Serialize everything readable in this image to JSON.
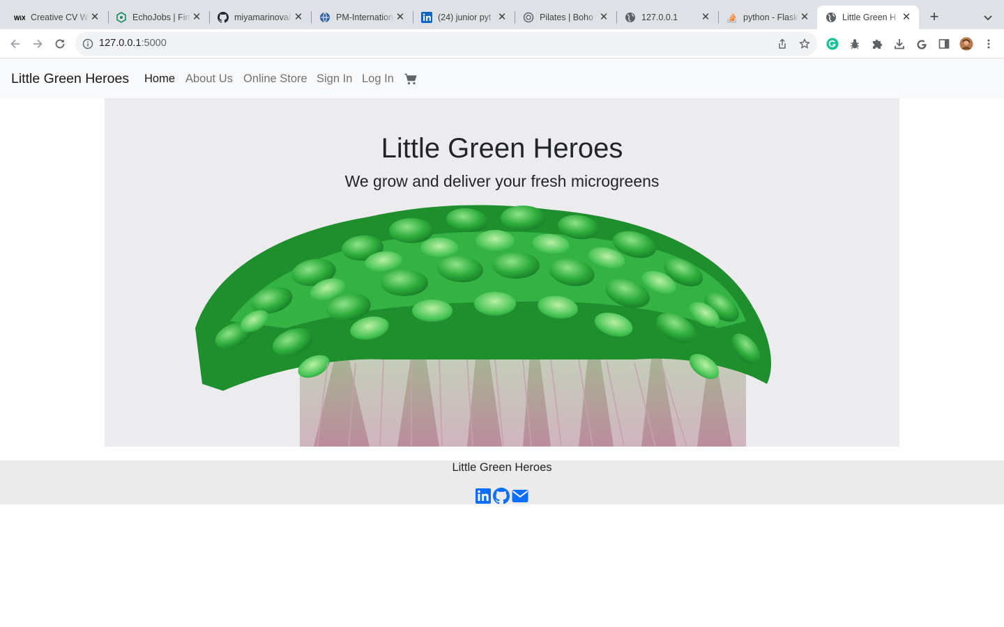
{
  "browser": {
    "tabs": [
      {
        "title": "Creative CV W",
        "icon": "wix-icon"
      },
      {
        "title": "EchoJobs | Fin",
        "icon": "echojobs-icon"
      },
      {
        "title": "miyamarinova/",
        "icon": "github-icon"
      },
      {
        "title": "PM-Internation",
        "icon": "globe-logo-icon"
      },
      {
        "title": "(24) junior pyt",
        "icon": "linkedin-icon"
      },
      {
        "title": "Pilates | Boho",
        "icon": "circle-logo-icon"
      },
      {
        "title": "127.0.0.1",
        "icon": "globe-icon"
      },
      {
        "title": "python - Flask",
        "icon": "stackoverflow-icon"
      },
      {
        "title": "Little Green H",
        "icon": "globe-icon"
      }
    ],
    "url_host": "127.0.0.1",
    "url_port": ":5000"
  },
  "site": {
    "brand": "Little Green Heroes",
    "nav": [
      {
        "label": "Home"
      },
      {
        "label": "About Us"
      },
      {
        "label": "Online Store"
      },
      {
        "label": "Sign In"
      },
      {
        "label": "Log In"
      }
    ],
    "hero_title": "Little Green Heroes",
    "hero_subtitle": "We grow and deliver your fresh microgreens",
    "footer_title": "Little Green Heroes",
    "social_icons": [
      "linkedin-icon",
      "github-icon",
      "envelope-icon"
    ],
    "link_color": "#0d6efd"
  }
}
